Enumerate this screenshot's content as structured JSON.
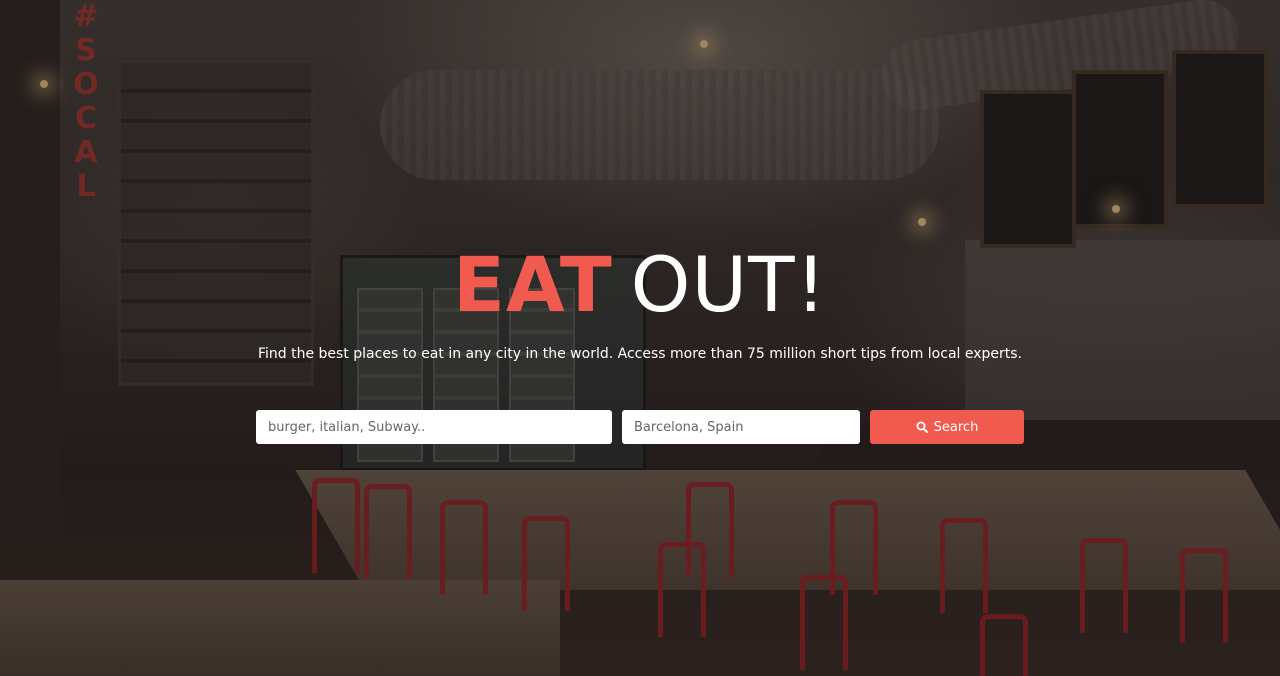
{
  "hero": {
    "title_accent": "EAT",
    "title_rest": "OUT!",
    "tagline": "Find the best places to eat in any city in the world. Access more than 75 million short tips from local experts."
  },
  "search": {
    "query_placeholder": "burger, italian, Subway..",
    "location_placeholder": "Barcelona, Spain",
    "button_label": "Search",
    "button_icon": "search-icon"
  },
  "colors": {
    "accent": "#f15a4f",
    "text_light": "#ffffff"
  }
}
